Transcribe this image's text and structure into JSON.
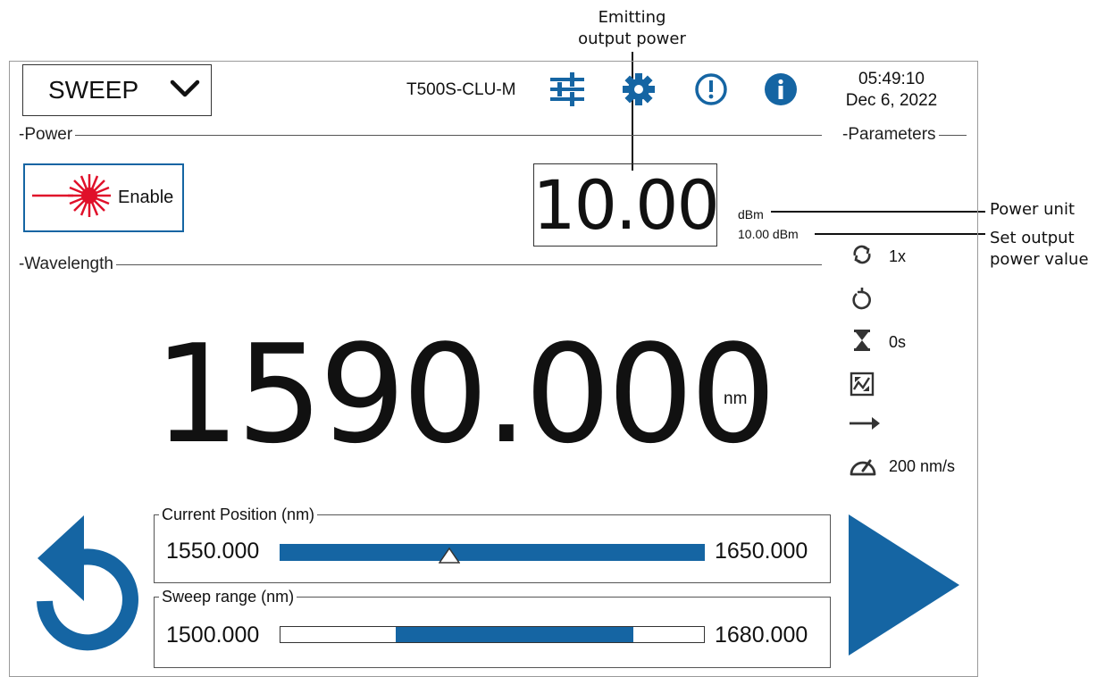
{
  "callouts": {
    "emitting_line1": "Emitting",
    "emitting_line2": "output power",
    "power_unit": "Power unit",
    "set_output_line1": "Set output",
    "set_output_line2": "power value"
  },
  "header": {
    "mode": "SWEEP",
    "device": "T500S-CLU-M",
    "time": "05:49:10",
    "date": "Dec 6, 2022",
    "icons": [
      "sliders-icon",
      "gear-icon",
      "alert-icon",
      "info-icon"
    ]
  },
  "sections": {
    "power": "Power",
    "parameters": "Parameters",
    "wavelength": "Wavelength"
  },
  "power": {
    "enable_label": "Enable",
    "emitting_value": "10.00",
    "unit": "dBm",
    "set_value": "10.00 dBm"
  },
  "parameters": {
    "cycles": "1x",
    "dwell": "0s",
    "speed": "200 nm/s"
  },
  "wavelength": {
    "value": "1590.000",
    "unit": "nm"
  },
  "current_position": {
    "label": "Current Position  (nm)",
    "min": "1550.000",
    "max": "1650.000",
    "position_fraction": 0.4
  },
  "sweep_range": {
    "label": "Sweep range (nm)",
    "min": "1500.000",
    "max": "1680.000",
    "start_fraction": 0.27,
    "end_fraction": 0.83
  },
  "colors": {
    "accent": "#1565a3",
    "laser": "#e0102a"
  }
}
